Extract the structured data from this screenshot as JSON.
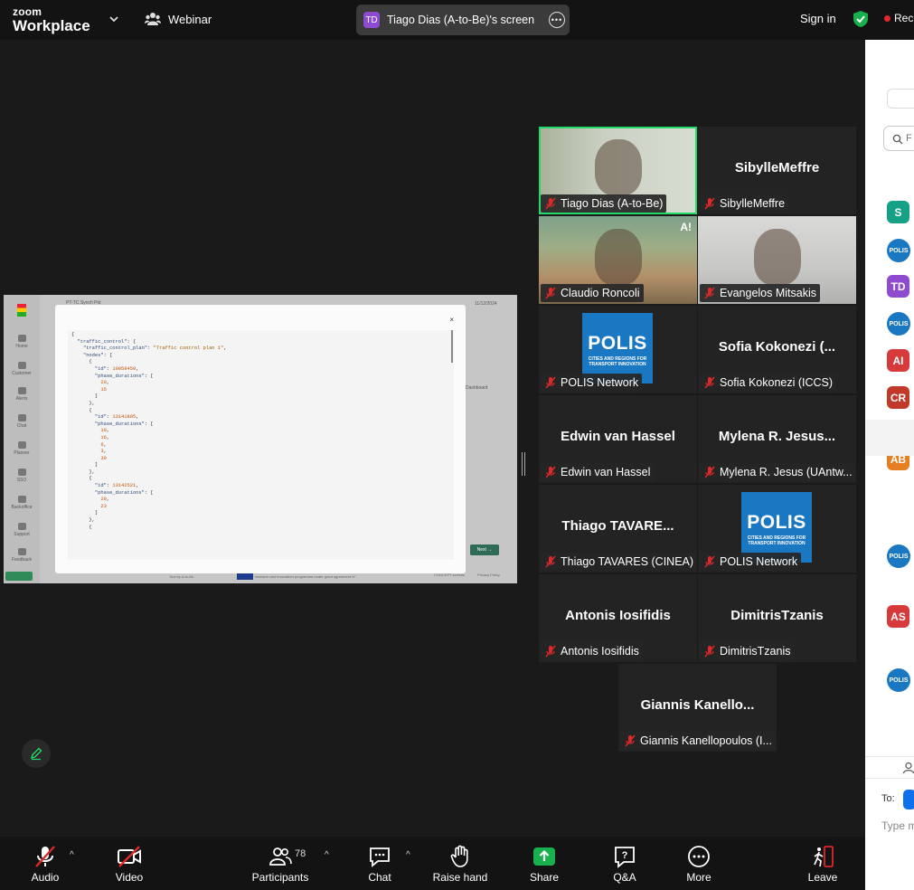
{
  "app": {
    "brand_top": "zoom",
    "brand_bottom": "Workplace"
  },
  "topbar": {
    "webinar_label": "Webinar",
    "share_badge": "TD",
    "share_title": "Tiago Dias (A-to-Be)'s screen",
    "signin": "Sign in",
    "recording": "Reco"
  },
  "shared_screen": {
    "app_title": "PT-TC Synch Pid",
    "date": "11/12/2024",
    "nav": [
      "Home",
      "Customer",
      "Alerts",
      "Chat",
      "Planner",
      "SSO",
      "Backoffice",
      "Support",
      "Feedback"
    ],
    "alerts_badge": "99+",
    "dashboard": "Dashboard",
    "next_button": "Next →",
    "footer_left": "Tool by A-to-Be",
    "footer_eu": "research and innovation programme under grant agreement N°",
    "footer_links": [
      "CONCEPT website",
      "Privacy Policy"
    ],
    "dialog_close": "×"
  },
  "gallery": [
    {
      "name": "Tiago Dias (A-to-Be)",
      "type": "video",
      "style": "vid1",
      "active": true
    },
    {
      "name": "SibylleMeffre",
      "type": "name",
      "label": "SibylleMeffre"
    },
    {
      "name": "Claudio Roncoli",
      "type": "video",
      "style": "vid2",
      "badge": "A!"
    },
    {
      "name": "Evangelos Mitsakis",
      "type": "video",
      "style": "vid3"
    },
    {
      "name": "POLIS Network",
      "type": "logo"
    },
    {
      "name": "Sofia Kokonezi (ICCS)",
      "type": "name",
      "label": "Sofia Kokonezi  (..."
    },
    {
      "name": "Edwin van Hassel",
      "type": "name",
      "label": "Edwin van Hassel"
    },
    {
      "name": "Mylena R. Jesus (UAntw...",
      "type": "name",
      "label": "Mylena R. Jesus..."
    },
    {
      "name": "Thiago TAVARES (CINEA)",
      "type": "name",
      "label": "Thiago  TAVARE..."
    },
    {
      "name": "POLIS Network",
      "type": "logo"
    },
    {
      "name": "Antonis Iosifidis",
      "type": "name",
      "label": "Antonis Iosifidis"
    },
    {
      "name": "DimitrisTzanis",
      "type": "name",
      "label": "DimitrisTzanis"
    },
    {
      "name": "Giannis Kanellopoulos (I...",
      "type": "name",
      "label": "Giannis  Kanello..."
    }
  ],
  "polis_logo": {
    "big": "POLIS",
    "small": "CITIES AND REGIONS FOR TRANSPORT INNOVATION"
  },
  "right_panel": {
    "search_placeholder": "F",
    "avatars": [
      {
        "initials": "S",
        "color": "#16a085"
      },
      {
        "initials": "POLIS",
        "color": "#1a77c2",
        "round": true
      },
      {
        "initials": "TD",
        "color": "#8f4bd0"
      },
      {
        "initials": "POLIS",
        "color": "#1a77c2",
        "round": true
      },
      {
        "initials": "AI",
        "color": "#d63a3a"
      },
      {
        "initials": "CR",
        "color": "#c0392b"
      }
    ],
    "lower_avatars": [
      {
        "initials": "AB",
        "color": "#e67e22"
      },
      {
        "initials": "POLIS",
        "color": "#1a77c2",
        "round": true
      },
      {
        "initials": "AS",
        "color": "#d63a3a"
      },
      {
        "initials": "POLIS",
        "color": "#1a77c2",
        "round": true
      }
    ],
    "to_label": "To:",
    "type_placeholder": "Type m"
  },
  "toolbar": {
    "audio": "Audio",
    "video": "Video",
    "participants": "Participants",
    "participants_count": "78",
    "chat": "Chat",
    "raise_hand": "Raise hand",
    "share": "Share",
    "qa": "Q&A",
    "more": "More",
    "leave": "Leave"
  },
  "colors": {
    "accent_green": "#23d967",
    "share_green": "#17b04c",
    "leave_red": "#e02828",
    "zoom_blue": "#0e71eb"
  }
}
